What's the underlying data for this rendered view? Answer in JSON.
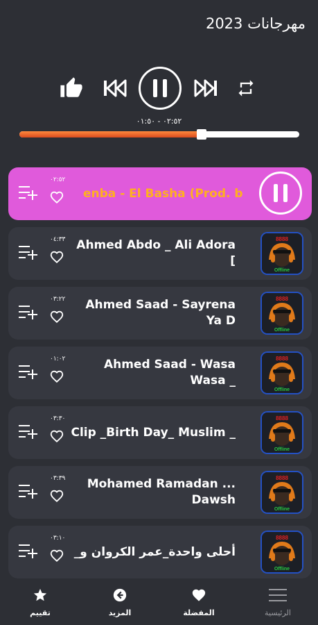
{
  "app": {
    "title": "مهرجانات 2023"
  },
  "player": {
    "time_text": "٠٢:٥٢ - ٠١:٥٠",
    "progress": 0.64
  },
  "songs": [
    {
      "title": "enba - El Basha (Prod. by",
      "duration": "٠٢:٥٢",
      "active": true
    },
    {
      "title": "Ahmed Abdo _ Ali Adora [",
      "duration": "٠٤:٣٣",
      "active": false
    },
    {
      "title": "Ahmed Saad - Sayrena Ya D",
      "duration": "٠٣:٢٢",
      "active": false
    },
    {
      "title": "Ahmed Saad - Wasa Wasa _",
      "duration": "٠١:٠٢",
      "active": false
    },
    {
      "title": "Clip _Birth Day_ Muslim _",
      "duration": "٠٣:٣٠",
      "active": false
    },
    {
      "title": "Mohamed Ramadan ... Dawsh",
      "duration": "٠٣:٣٩",
      "active": false
    },
    {
      "title": "_أحلى واحدة_عمر الكروان و",
      "duration": "٠٣:١٠",
      "active": false
    }
  ],
  "thumb_labels": {
    "top": "8888",
    "bottom": "Offline"
  },
  "nav": {
    "home": "الرئيسية",
    "favorites": "المفضلة",
    "more": "المزيد",
    "rate": "تقييم"
  },
  "colors": {
    "background": "#2d2f35",
    "active_row": "#e05adb",
    "active_title": "#ffb020",
    "progress": "#e8642a"
  }
}
